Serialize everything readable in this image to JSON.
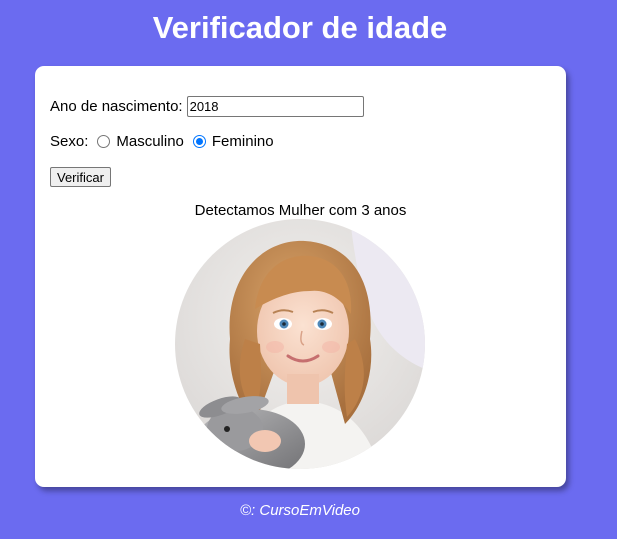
{
  "header": {
    "title": "Verificador de idade"
  },
  "form": {
    "year_label": "Ano de nascimento:",
    "year_value": "2018",
    "sex_label": "Sexo:",
    "options": [
      {
        "label": "Masculino",
        "checked": false
      },
      {
        "label": "Feminino",
        "checked": true
      }
    ],
    "button_label": "Verificar"
  },
  "result": {
    "text": "Detectamos Mulher com 3 anos",
    "image": "girl-with-rabbit-photo"
  },
  "footer": {
    "text": "©: CursoEmVideo"
  },
  "colors": {
    "background": "#6b6bf0",
    "card": "#ffffff",
    "radio_accent": "#0075ff"
  }
}
